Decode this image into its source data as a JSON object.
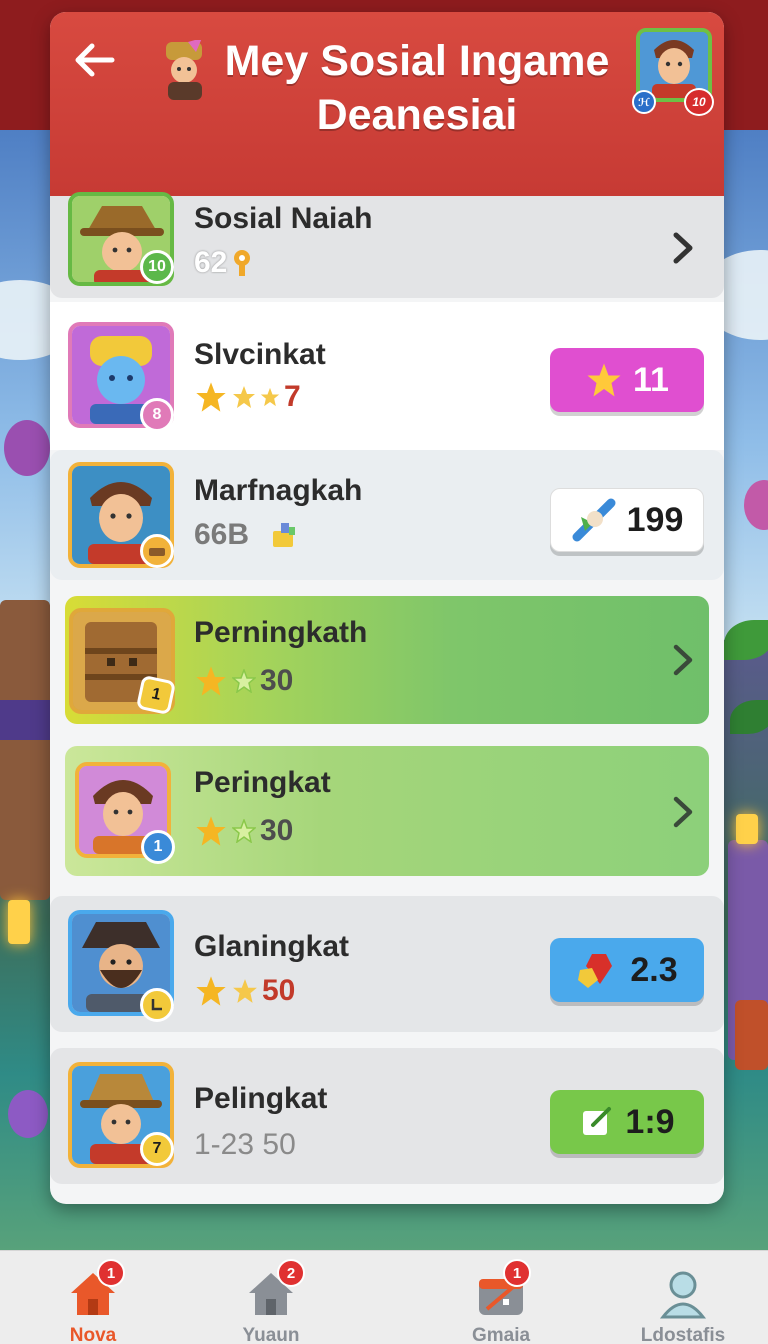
{
  "header": {
    "title": "Mey Sosial Ingame Deanesiai",
    "profile_badge_left": "ℋ",
    "profile_badge_right": "10"
  },
  "rows": [
    {
      "name": "Sosial Naiah",
      "sub": "62",
      "badge": "10",
      "action": "chevron"
    },
    {
      "name": "Slvcinkat",
      "sub": "7",
      "badge": "8",
      "action_value": "11",
      "action_icon": "star-icon",
      "action_color": "#e04fd0"
    },
    {
      "name": "Marfnagkah",
      "sub": "66B",
      "badge": "",
      "action_value": "199",
      "action_icon": "gem-feather-icon",
      "action_color": "#ffffff"
    },
    {
      "name": "Perningkath",
      "sub": "30",
      "badge": "1",
      "action": "chevron"
    },
    {
      "name": "Peringkat",
      "sub": "30",
      "badge": "1",
      "action": "chevron"
    },
    {
      "name": "Glaningkat",
      "sub": "50",
      "badge": "",
      "action_value": "2.3",
      "action_icon": "gem-cluster-icon",
      "action_color": "#4aa9ec"
    },
    {
      "name": "Pelingkat",
      "sub": "1-23 50",
      "badge": "7",
      "action_value": "1:9",
      "action_icon": "edit-note-icon",
      "action_color": "#78c84a"
    }
  ],
  "nav": [
    {
      "label": "Nova",
      "badge": "1",
      "icon": "home-icon",
      "active": true
    },
    {
      "label": "Yuaun",
      "badge": "2",
      "icon": "home-icon",
      "active": false
    },
    {
      "label": "Gmaia",
      "badge": "1",
      "icon": "calendar-icon",
      "active": false
    },
    {
      "label": "Ldostafis",
      "badge": "",
      "icon": "person-icon",
      "active": false
    }
  ],
  "colors": {
    "header": "#c63a34",
    "accent_green": "#78c84a",
    "accent_pink": "#e04fd0",
    "accent_blue": "#4aa9ec",
    "nav_active": "#e9582a"
  }
}
